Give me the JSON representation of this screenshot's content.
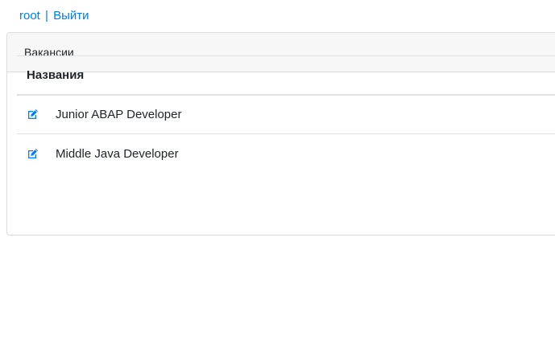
{
  "header": {
    "user_link": "root",
    "separator": "|",
    "logout_link": "Выйти"
  },
  "card": {
    "title": "Вакансии",
    "table": {
      "column_header": "Названия",
      "rows": [
        {
          "name": "Junior ABAP Developer",
          "icon": "edit-icon"
        },
        {
          "name": "Middle Java Developer",
          "icon": "edit-icon"
        }
      ]
    }
  },
  "colors": {
    "link": "#007bff",
    "card_header_bg": "#f7f7f7",
    "border": "#dcdcdc"
  }
}
